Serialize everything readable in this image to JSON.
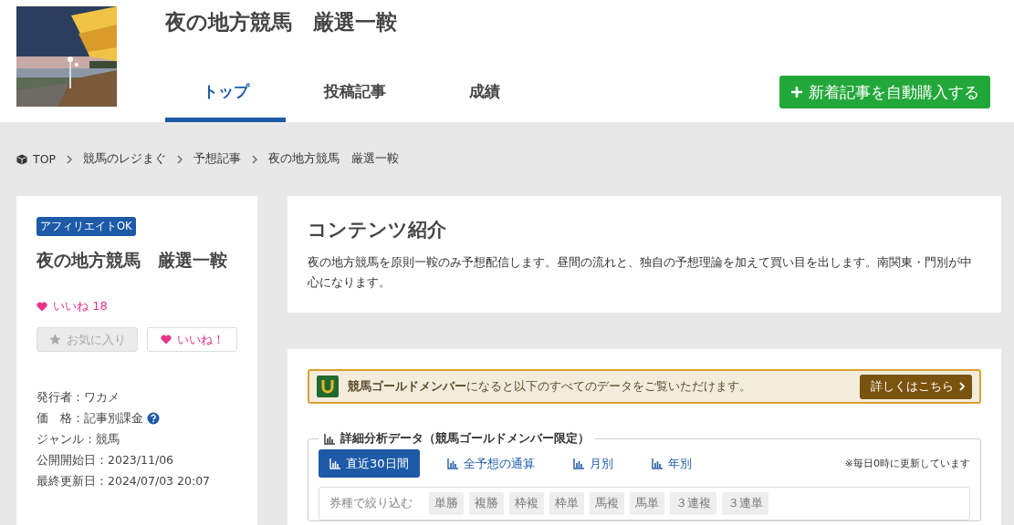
{
  "header": {
    "title": "夜の地方競馬　厳選一鞍",
    "tabs": [
      {
        "label": "トップ",
        "selected": true
      },
      {
        "label": "投稿記事",
        "selected": false
      },
      {
        "label": "成績",
        "selected": false
      }
    ],
    "auto_buy_button": "新着記事を自動購入する"
  },
  "breadcrumb": [
    "TOP",
    "競馬のレジまぐ",
    "予想記事",
    "夜の地方競馬　厳選一鞍"
  ],
  "sidebar": {
    "badge": "アフィリエイトOK",
    "title": "夜の地方競馬　厳選一鞍",
    "likes": "いいね 18",
    "favorite_button": {
      "label": "お気に入り",
      "disabled": true
    },
    "like_button": {
      "label": "いいね！",
      "disabled": false
    },
    "meta": [
      {
        "text": "発行者：ワカメ",
        "help": false
      },
      {
        "text": "価　格：記事別課金",
        "help": true
      },
      {
        "text": "ジャンル：競馬",
        "help": false
      },
      {
        "text": "公開開始日：2023/11/06",
        "help": false
      },
      {
        "text": "最終更新日：2024/07/03 20:07",
        "help": false
      }
    ]
  },
  "intro": {
    "heading": "コンテンツ紹介",
    "text": "夜の地方競馬を原則一鞍のみ予想配信します。昼間の流れと、独自の予想理論を加えて買い目を出します。南関東・門別が中心になります。"
  },
  "gold_banner": {
    "text": "**競馬ゴールドメンバー**になると以下のすべてのデータをご覧いただけます。",
    "button": "詳しくはこちら"
  },
  "analysis": {
    "legend": "詳細分析データ（競馬ゴールドメンバー限定）",
    "tabs": [
      {
        "label": "直近30日間",
        "selected": true
      },
      {
        "label": "全予想の通算",
        "selected": false
      },
      {
        "label": "月別",
        "selected": false
      },
      {
        "label": "年別",
        "selected": false
      }
    ],
    "note": "※毎日0時に更新しています",
    "filter_label": "券種で絞り込む",
    "filters": [
      "単勝",
      "複勝",
      "枠複",
      "枠単",
      "馬複",
      "馬単",
      "３連複",
      "３連単"
    ]
  }
}
